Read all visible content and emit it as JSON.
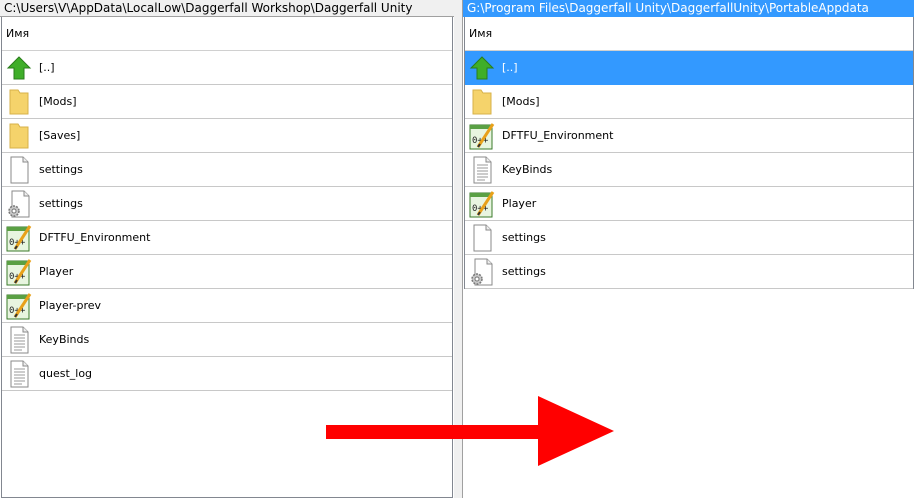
{
  "left": {
    "path": "C:\\Users\\V\\AppData\\LocalLow\\Daggerfall Workshop\\Daggerfall Unity",
    "column_header": "Имя",
    "items": [
      {
        "name": "[..]",
        "icon": "up-arrow-icon"
      },
      {
        "name": "[Mods]",
        "icon": "folder-icon"
      },
      {
        "name": "[Saves]",
        "icon": "folder-icon"
      },
      {
        "name": "settings",
        "icon": "blank-file-icon"
      },
      {
        "name": "settings",
        "icon": "settings-file-icon"
      },
      {
        "name": "DFTFU_Environment",
        "icon": "editor-file-icon"
      },
      {
        "name": "Player",
        "icon": "editor-file-icon"
      },
      {
        "name": "Player-prev",
        "icon": "editor-file-icon"
      },
      {
        "name": "KeyBinds",
        "icon": "text-file-icon"
      },
      {
        "name": "quest_log",
        "icon": "text-file-icon"
      }
    ]
  },
  "right": {
    "path": "G:\\Program Files\\Daggerfall Unity\\DaggerfallUnity\\PortableAppdata",
    "column_header": "Имя",
    "items": [
      {
        "name": "[..]",
        "icon": "up-arrow-icon",
        "selected": true
      },
      {
        "name": "[Mods]",
        "icon": "folder-icon"
      },
      {
        "name": "DFTFU_Environment",
        "icon": "editor-file-icon"
      },
      {
        "name": "KeyBinds",
        "icon": "text-file-icon"
      },
      {
        "name": "Player",
        "icon": "editor-file-icon"
      },
      {
        "name": "settings",
        "icon": "blank-file-icon"
      },
      {
        "name": "settings",
        "icon": "settings-file-icon"
      }
    ]
  },
  "colors": {
    "selection": "#3399ff",
    "arrow": "#ff0000",
    "folder": "#f5d36b",
    "up_arrow": "#3fae29"
  }
}
